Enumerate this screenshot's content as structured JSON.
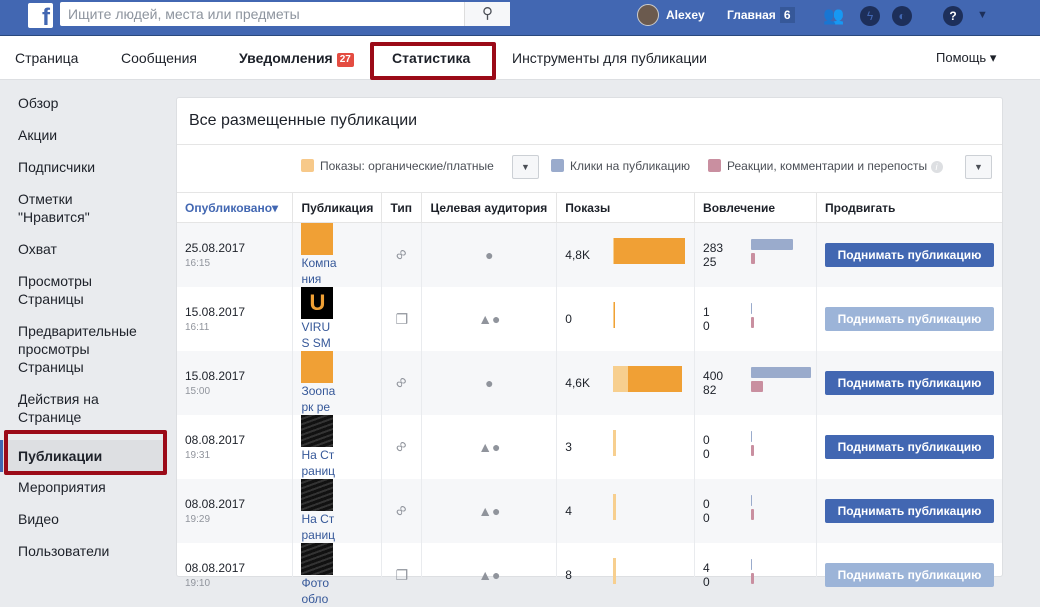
{
  "topbar": {
    "logo": "f",
    "search_placeholder": "Ищите людей, места или предметы",
    "user": "Alexey",
    "home": "Главная",
    "home_count": "6"
  },
  "tabs": [
    {
      "label": "Страница"
    },
    {
      "label": "Сообщения"
    },
    {
      "label": "Уведомления",
      "badge": "27"
    },
    {
      "label": "Статистика"
    },
    {
      "label": "Инструменты для публикации"
    }
  ],
  "help": "Помощь ▾",
  "sidebar": [
    "Обзор",
    "Акции",
    "Подписчики",
    "Отметки \"Нравится\"",
    "Охват",
    "Просмотры Страницы",
    "Предварительные просмотры Страницы",
    "Действия на Странице",
    "Публикации",
    "Мероприятия",
    "Видео",
    "Пользователи"
  ],
  "card": {
    "title": "Все размещенные публикации",
    "legend": {
      "impressions": "Показы: органические/платные",
      "clicks": "Клики на публикацию",
      "reactions": "Реакции, комментарии и перепосты"
    },
    "columns": [
      "Опубликовано▾",
      "Публикация",
      "Тип",
      "Целевая аудитория",
      "Показы",
      "Вовлечение",
      "Продвигать"
    ],
    "rows": [
      {
        "date": "25.08.2017",
        "time": "16:15",
        "title": "Компания",
        "type": "link",
        "audience": "public",
        "impressions": "4,8K",
        "imp_value": 4800,
        "organic_share": 0,
        "clicks": "283",
        "reactions": "25",
        "promote": "Поднимать публикацию",
        "promote_enabled": true,
        "thumb": "orange"
      },
      {
        "date": "15.08.2017",
        "time": "16:11",
        "title": "VIRUS SM",
        "type": "photo",
        "audience": "restricted",
        "impressions": "0",
        "imp_value": 0,
        "organic_share": 0,
        "clicks": "1",
        "reactions": "0",
        "promote": "Поднимать публикацию",
        "promote_enabled": false,
        "thumb": "virus"
      },
      {
        "date": "15.08.2017",
        "time": "15:00",
        "title": "Зоопарк ре",
        "type": "link",
        "audience": "public",
        "impressions": "4,6K",
        "imp_value": 4600,
        "organic_share": 0.2,
        "clicks": "400",
        "reactions": "82",
        "promote": "Поднимать публикацию",
        "promote_enabled": true,
        "thumb": "orange"
      },
      {
        "date": "08.08.2017",
        "time": "19:31",
        "title": "На Страниц",
        "type": "link",
        "audience": "restricted",
        "impressions": "3",
        "imp_value": 3,
        "organic_share": 1,
        "clicks": "0",
        "reactions": "0",
        "promote": "Поднимать публикацию",
        "promote_enabled": true,
        "thumb": "dark"
      },
      {
        "date": "08.08.2017",
        "time": "19:29",
        "title": "На Страниц",
        "type": "link",
        "audience": "restricted",
        "impressions": "4",
        "imp_value": 4,
        "organic_share": 1,
        "clicks": "0",
        "reactions": "0",
        "promote": "Поднимать публикацию",
        "promote_enabled": true,
        "thumb": "dark"
      },
      {
        "date": "08.08.2017",
        "time": "19:10",
        "title": "Фото обло",
        "type": "photo",
        "audience": "restricted",
        "impressions": "8",
        "imp_value": 8,
        "organic_share": 1,
        "clicks": "4",
        "reactions": "0",
        "promote": "Поднимать публикацию",
        "promote_enabled": false,
        "thumb": "dark"
      }
    ]
  },
  "colors": {
    "paid": "#f0a035",
    "organic": "#f7cf8f",
    "clicks": "#9aabcc",
    "reactions": "#c98fa0"
  }
}
